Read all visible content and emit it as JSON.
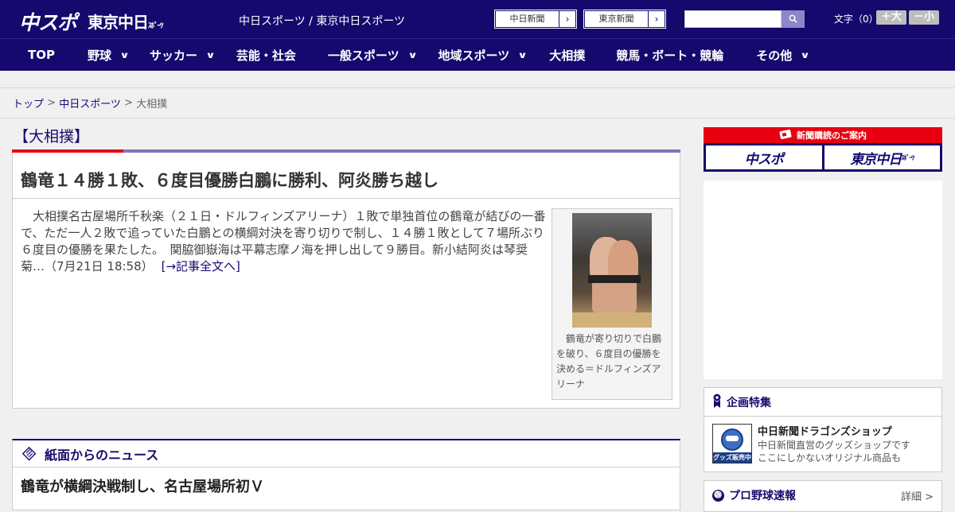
{
  "header": {
    "logo_chuspo": "中スポ",
    "logo_tokyo": "東京中日",
    "logo_tokyo_sub": "ｽﾎﾟｰﾂ",
    "site_title": "中日スポーツ / 東京中日スポーツ",
    "paper_links": [
      {
        "label": "中日新聞",
        "arrow": "›"
      },
      {
        "label": "東京新聞",
        "arrow": "›"
      }
    ],
    "search_placeholder": "",
    "search_icon": "search-icon",
    "font_size_label": "文字（0）",
    "font_plus": "＋大",
    "font_minus": "－小"
  },
  "nav": {
    "items": [
      {
        "label": "TOP",
        "has_menu": false
      },
      {
        "label": "野球",
        "has_menu": true
      },
      {
        "label": "サッカー",
        "has_menu": true
      },
      {
        "label": "芸能・社会",
        "has_menu": false
      },
      {
        "label": "一般スポーツ",
        "has_menu": true
      },
      {
        "label": "地域スポーツ",
        "has_menu": true
      },
      {
        "label": "大相撲",
        "has_menu": false
      },
      {
        "label": "競馬・ボート・競輪",
        "has_menu": false
      },
      {
        "label": "その他",
        "has_menu": true
      }
    ],
    "chevron": "∨"
  },
  "breadcrumb": {
    "top": "トップ",
    "sep": " > ",
    "section": "中日スポーツ",
    "current": "大相撲"
  },
  "main": {
    "category_title": "【大相撲】",
    "headline": "鶴竜１４勝１敗、６度目優勝白鵬に勝利、阿炎勝ち越し",
    "body": "　大相撲名古屋場所千秋楽（２１日・ドルフィンズアリーナ）１敗で単独首位の鶴竜が結びの一番で、ただ一人２敗で追っていた白鵬との横綱対決を寄り切りで制し、１４勝１敗として７場所ぶり６度目の優勝を果たした。　関脇御嶽海は平幕志摩ノ海を押し出して９勝目。新小結阿炎は琴奨菊…（7月21日 18:58）",
    "more_link": "[→記事全文へ]",
    "photo_caption": "鶴竜が寄り切りで白鵬を破り、６度目の優勝を決める＝ドルフィンズアリーナ"
  },
  "news": {
    "title": "紙面からのニュース",
    "first_item": "鶴竜が横綱決戦制し、名古屋場所初Ｖ"
  },
  "sidebar": {
    "subscription_title": "新聞購読のご案内",
    "logo_chuspo": "中スポ",
    "logo_tokyo": "東京中日",
    "logo_tokyo_sub": "ｽﾎﾟｰﾂ",
    "feature_title": "企画特集",
    "feature_item_title": "中日新聞ドラゴンズショップ",
    "feature_item_desc1": "中日新聞直営のグッズショップです",
    "feature_item_desc2": "ここにしかないオリジナル商品も",
    "feature_thumb_label": "グッズ販売中",
    "baseball_title": "プロ野球速報",
    "baseball_detail": "詳細 >"
  },
  "colors": {
    "brand_navy": "#15096e",
    "accent_red": "#e60012",
    "rule_purple": "#7b78bc"
  }
}
